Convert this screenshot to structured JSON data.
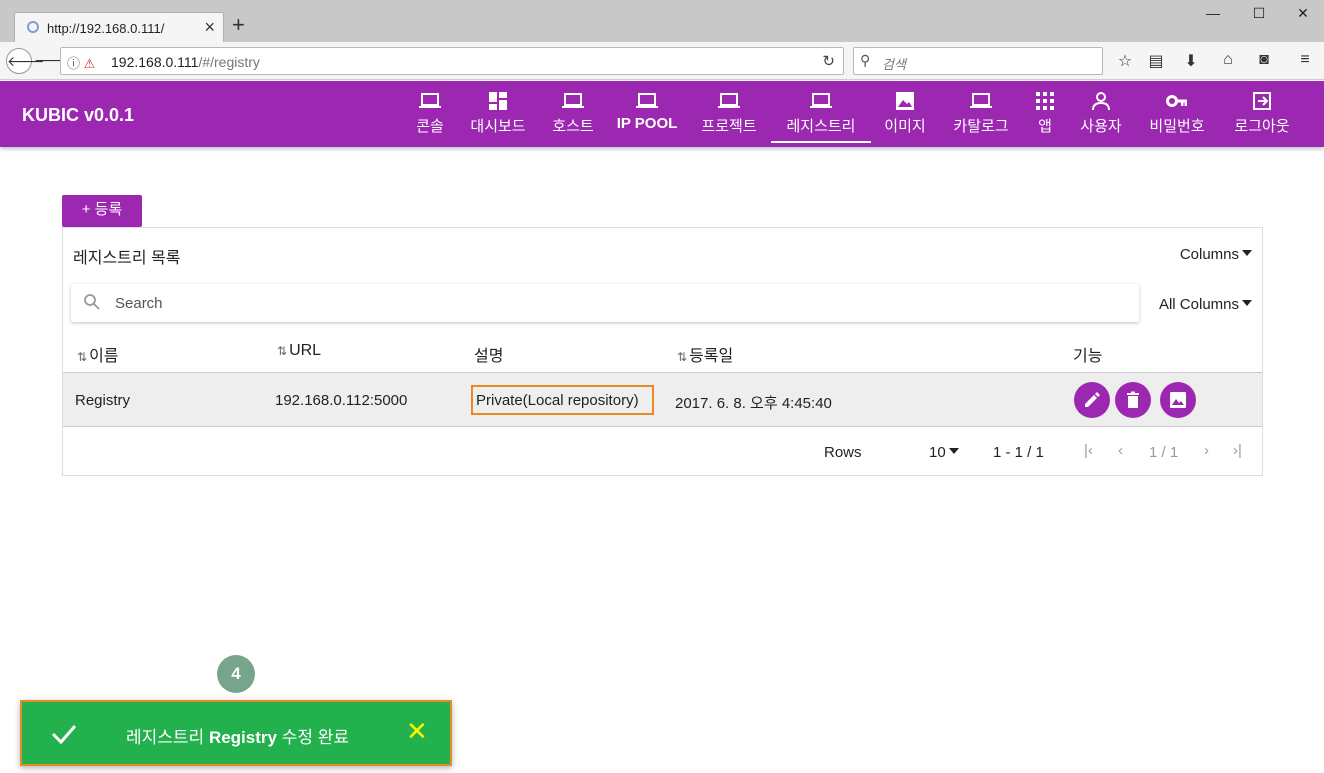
{
  "browser": {
    "tab_title": "http://192.168.0.111/",
    "url_host": "192.168.0.111",
    "url_path": "/#/registry",
    "search_placeholder": "검색"
  },
  "header": {
    "brand": "KUBIC v0.0.1",
    "menu": [
      {
        "label": "콘솔",
        "icon": "laptop-icon"
      },
      {
        "label": "대시보드",
        "icon": "dashboard-icon"
      },
      {
        "label": "호스트",
        "icon": "laptop-icon"
      },
      {
        "label": "IP POOL",
        "icon": "laptop-icon"
      },
      {
        "label": "프로젝트",
        "icon": "laptop-icon"
      },
      {
        "label": "레지스트리",
        "icon": "laptop-icon",
        "active": true
      },
      {
        "label": "이미지",
        "icon": "image-icon"
      },
      {
        "label": "카탈로그",
        "icon": "laptop-icon"
      },
      {
        "label": "앱",
        "icon": "apps-grid-icon"
      },
      {
        "label": "사용자",
        "icon": "person-icon"
      },
      {
        "label": "비밀번호",
        "icon": "key-icon"
      },
      {
        "label": "로그아웃",
        "icon": "logout-icon"
      }
    ]
  },
  "toolbar": {
    "add_label": "+ 등록"
  },
  "card": {
    "title": "레지스트리 목록",
    "columns_label": "Columns",
    "search_placeholder": "Search",
    "all_columns_label": "All Columns"
  },
  "table": {
    "headers": {
      "name": "이름",
      "url": "URL",
      "desc": "설명",
      "date": "등록일",
      "actions": "기능"
    },
    "rows": [
      {
        "name": "Registry",
        "url": "192.168.0.112:5000",
        "desc": "Private(Local repository)",
        "date": "2017. 6. 8. 오후 4:45:40"
      }
    ]
  },
  "pagination": {
    "rows_label": "Rows",
    "rows_value": "10",
    "range": "1 - 1 / 1",
    "page": "1 / 1"
  },
  "annotation": {
    "step": "4"
  },
  "toast": {
    "prefix": "레지스트리",
    "name": "Registry",
    "suffix": "수정 완료",
    "colors": {
      "bg": "#22b14c",
      "close": "#f5f500"
    }
  },
  "colors": {
    "primary": "#9c27b0",
    "highlight_border": "#e88a2a"
  }
}
